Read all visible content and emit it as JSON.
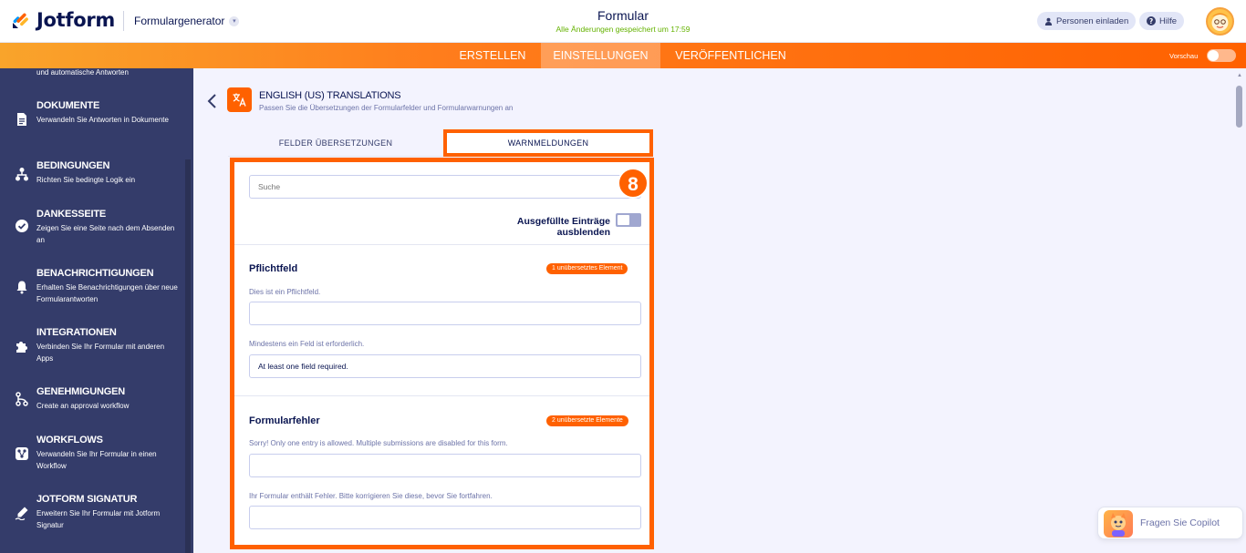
{
  "topbar": {
    "brand": "Jotform",
    "form_builder": "Formulargenerator",
    "form_title": "Formular",
    "save_status": "Alle Änderungen gespeichert um 17:59",
    "invite_label": "Personen einladen",
    "help_label": "Hilfe"
  },
  "nav": {
    "items": [
      "ERSTELLEN",
      "EINSTELLUNGEN",
      "VERÖFFENTLICHEN"
    ],
    "active": "EINSTELLUNGEN",
    "preview_label": "Vorschau"
  },
  "sidebar": {
    "top_text": "und automatische Antworten",
    "items": [
      {
        "title": "DOKUMENTE",
        "desc": "Verwandeln Sie Antworten in Dokumente",
        "icon": "document-icon"
      },
      {
        "title": "BEDINGUNGEN",
        "desc": "Richten Sie bedingte Logik ein",
        "icon": "conditions-icon"
      },
      {
        "title": "DANKESSEITE",
        "desc": "Zeigen Sie eine Seite nach dem Absenden an",
        "icon": "check-circle-icon"
      },
      {
        "title": "BENACHRICHTIGUNGEN",
        "desc": "Erhalten Sie Benachrichtigungen über neue Formularantworten",
        "icon": "bell-icon"
      },
      {
        "title": "INTEGRATIONEN",
        "desc": "Verbinden Sie Ihr Formular mit anderen Apps",
        "icon": "puzzle-icon"
      },
      {
        "title": "GENEHMIGUNGEN",
        "desc": "Create an approval workflow",
        "icon": "approval-flow-icon"
      },
      {
        "title": "WORKFLOWS",
        "desc": "Verwandeln Sie Ihr Formular in einen Workflow",
        "icon": "workflow-icon"
      },
      {
        "title": "JOTFORM SIGNATUR",
        "desc": "Erweitern Sie Ihr Formular mit Jotform Signatur",
        "icon": "signature-icon"
      }
    ]
  },
  "translations": {
    "title": "ENGLISH (US) TRANSLATIONS",
    "description": "Passen Sie die Übersetzungen der Formularfelder und Formularwarnungen an",
    "tabs": [
      "FELDER ÜBERSETZUNGEN",
      "WARNMELDUNGEN"
    ],
    "active_tab": "WARNMELDUNGEN",
    "search_placeholder": "Suche",
    "step_number": "8",
    "hide_filled_label": "Ausgefüllte Einträge ausblenden",
    "sections": [
      {
        "title": "Pflichtfeld",
        "badge": "1 unübersetztes Element",
        "fields": [
          {
            "label": "Dies ist ein Pflichtfeld.",
            "value": ""
          },
          {
            "label": "Mindestens ein Feld ist erforderlich.",
            "value": "At least one field required."
          }
        ]
      },
      {
        "title": "Formularfehler",
        "badge": "2 unübersetzte Elemente",
        "fields": [
          {
            "label": "Sorry! Only one entry is allowed. Multiple submissions are disabled for this form.",
            "value": ""
          },
          {
            "label": "Ihr Formular enthält Fehler. Bitte korrigieren Sie diese, bevor Sie fortfahren.",
            "value": ""
          }
        ]
      }
    ]
  },
  "copilot": {
    "label": "Fragen Sie Copilot"
  },
  "colors": {
    "accent": "#ff6100",
    "sidebar": "#343c6a",
    "save_status": "#64b200"
  }
}
